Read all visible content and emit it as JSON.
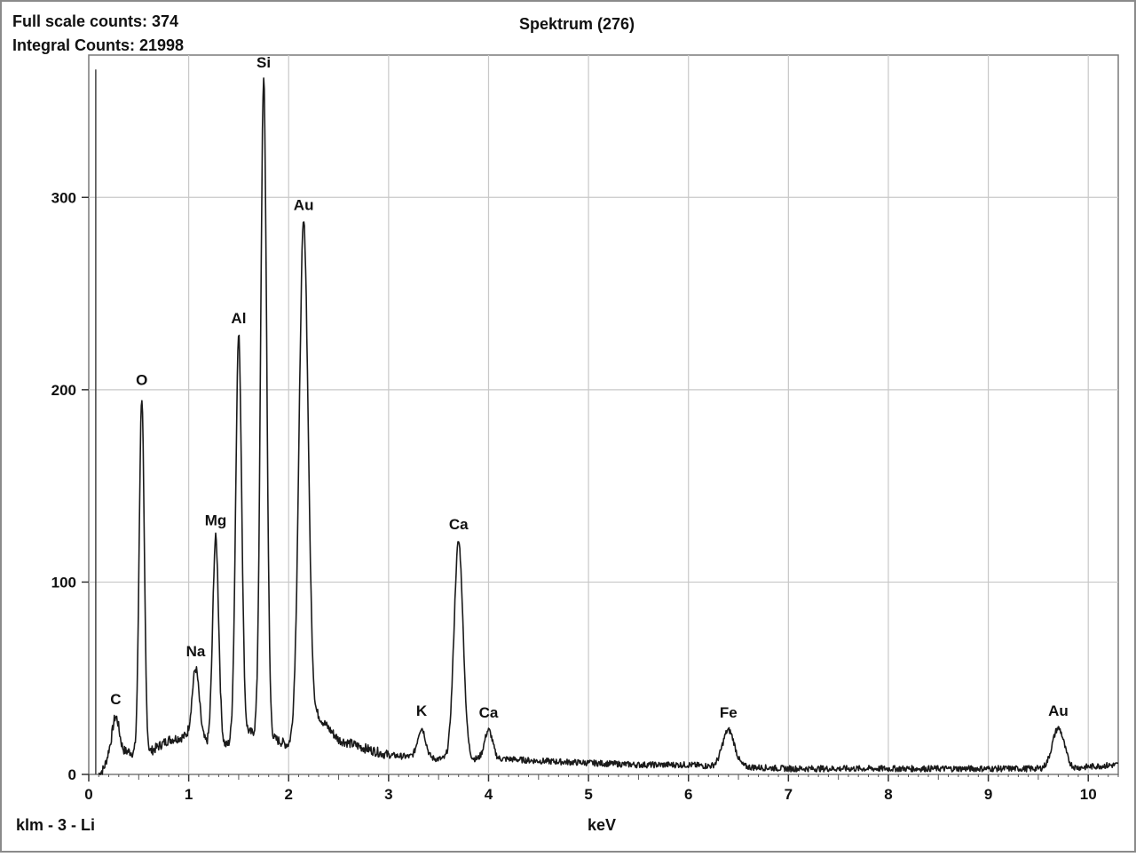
{
  "header": {
    "full_scale": "Full scale counts: 374",
    "integral": "Integral Counts: 21998"
  },
  "footer": {
    "sample_label": "klm - 3 - Li"
  },
  "colors": {
    "trace": "#1a1a1a",
    "grid": "#c8c8c8",
    "frame": "#7a7a7a",
    "text": "#111111"
  },
  "chart_data": {
    "type": "line",
    "title": "Spektrum (276)",
    "xlabel": "keV",
    "ylabel": "",
    "xlim": [
      0,
      10.3
    ],
    "ylim": [
      0,
      374
    ],
    "x_ticks": [
      "0",
      "1",
      "2",
      "3",
      "4",
      "5",
      "6",
      "7",
      "8",
      "9",
      "10"
    ],
    "y_ticks": [
      "0",
      "100",
      "200",
      "300"
    ],
    "grid": true,
    "marker_line_x": 0.07,
    "baseline": [
      [
        0.1,
        0
      ],
      [
        0.15,
        3
      ],
      [
        0.2,
        10
      ],
      [
        0.4,
        12
      ],
      [
        0.48,
        10
      ],
      [
        0.62,
        12
      ],
      [
        0.8,
        18
      ],
      [
        1.0,
        20
      ],
      [
        1.14,
        18
      ],
      [
        1.2,
        15
      ],
      [
        1.38,
        15
      ],
      [
        1.6,
        22
      ],
      [
        1.88,
        18
      ],
      [
        2.0,
        15
      ],
      [
        2.3,
        30
      ],
      [
        2.5,
        18
      ],
      [
        2.8,
        13
      ],
      [
        3.0,
        10
      ],
      [
        3.5,
        8
      ],
      [
        3.9,
        8
      ],
      [
        4.2,
        8
      ],
      [
        4.5,
        7
      ],
      [
        5.0,
        6
      ],
      [
        5.5,
        5
      ],
      [
        6.0,
        5
      ],
      [
        6.3,
        4
      ],
      [
        6.5,
        4
      ],
      [
        7.0,
        3
      ],
      [
        7.5,
        3
      ],
      [
        8.0,
        3
      ],
      [
        8.5,
        3
      ],
      [
        9.0,
        3
      ],
      [
        9.4,
        3
      ],
      [
        9.6,
        3
      ],
      [
        9.8,
        3
      ],
      [
        10.0,
        4
      ],
      [
        10.3,
        5
      ]
    ],
    "peaks": [
      {
        "label": "C",
        "x": 0.27,
        "y": 30,
        "w": 0.035
      },
      {
        "label": "O",
        "x": 0.53,
        "y": 196,
        "w": 0.025
      },
      {
        "label": "Na",
        "x": 1.07,
        "y": 55,
        "w": 0.035
      },
      {
        "label": "Mg",
        "x": 1.27,
        "y": 123,
        "w": 0.03
      },
      {
        "label": "Al",
        "x": 1.5,
        "y": 228,
        "w": 0.03
      },
      {
        "label": "Si",
        "x": 1.75,
        "y": 361,
        "w": 0.03
      },
      {
        "label": "Au",
        "x": 2.15,
        "y": 287,
        "w": 0.045
      },
      {
        "label": "K",
        "x": 3.33,
        "y": 24,
        "w": 0.04
      },
      {
        "label": "Ca",
        "x": 3.7,
        "y": 121,
        "w": 0.045
      },
      {
        "label": "Ca",
        "x": 4.0,
        "y": 23,
        "w": 0.04
      },
      {
        "label": "Fe",
        "x": 6.4,
        "y": 23,
        "w": 0.06
      },
      {
        "label": "Au",
        "x": 9.7,
        "y": 24,
        "w": 0.06
      }
    ]
  }
}
